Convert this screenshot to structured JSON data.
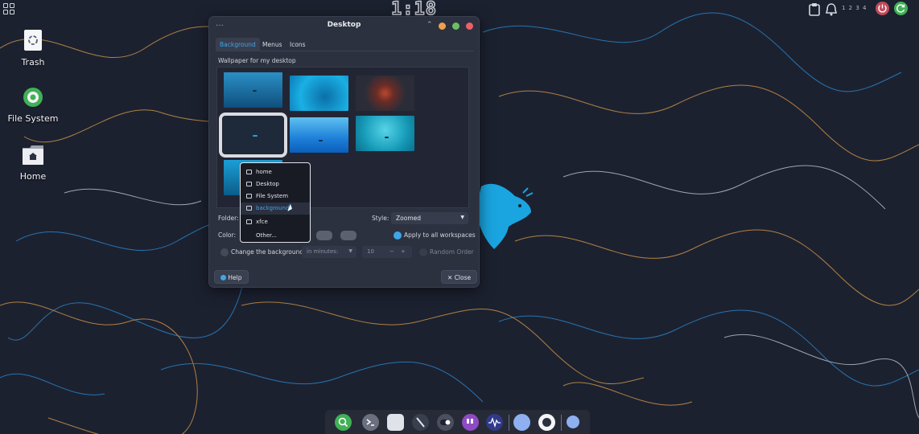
{
  "top_panel": {
    "clock": "1:18",
    "workspaces": "1 2 3 4",
    "icons": [
      "apps-grid-icon",
      "clipboard-icon",
      "notification-bell-icon",
      "power-icon",
      "refresh-icon"
    ]
  },
  "desktop_icons": [
    {
      "label": "Trash",
      "icon": "trash-icon"
    },
    {
      "label": "File System",
      "icon": "file-system-icon"
    },
    {
      "label": "Home",
      "icon": "home-folder-icon"
    }
  ],
  "window": {
    "title": "Desktop",
    "menu_glyph": "…",
    "minimize_glyph": "⌃",
    "tabs": [
      "Background",
      "Menus",
      "Icons"
    ],
    "active_tab": "Background",
    "section_label": "Wallpaper for my desktop",
    "folder_label": "Folder:",
    "style_label": "Style:",
    "style_value": "Zoomed",
    "color_label": "Color:",
    "apply_all_label": "Apply to all workspaces",
    "change_bg_label": "Change the background",
    "interval_value": "in minutes:",
    "interval_number": "10",
    "minus": "−",
    "plus": "+",
    "random_order_label": "Random Order",
    "help_label": "Help",
    "close_label": "Close",
    "close_glyph": "✕"
  },
  "folder_popup": {
    "items": [
      {
        "label": "home",
        "icon": "home-icon"
      },
      {
        "label": "Desktop",
        "icon": "desktop-icon"
      },
      {
        "label": "File System",
        "icon": "drive-icon"
      },
      {
        "label": "backgrounds",
        "icon": "folder-icon",
        "highlighted": true
      },
      {
        "label": "xfce",
        "icon": "folder-icon"
      },
      {
        "label": "Other...",
        "icon": ""
      }
    ]
  },
  "dock": {
    "items": [
      "search-icon",
      "terminal-icon",
      "files-icon",
      "pen-icon",
      "toggle-icon",
      "quote-app-icon",
      "waveform-icon",
      "chat-icon",
      "camera-icon",
      "bubble-icon"
    ]
  },
  "colors": {
    "accent": "#3ea6ea",
    "window_bg": "#2c3140",
    "desktop_bg": "#1c2130",
    "orange_line": "#c99246",
    "blue_line": "#2a83c6"
  }
}
